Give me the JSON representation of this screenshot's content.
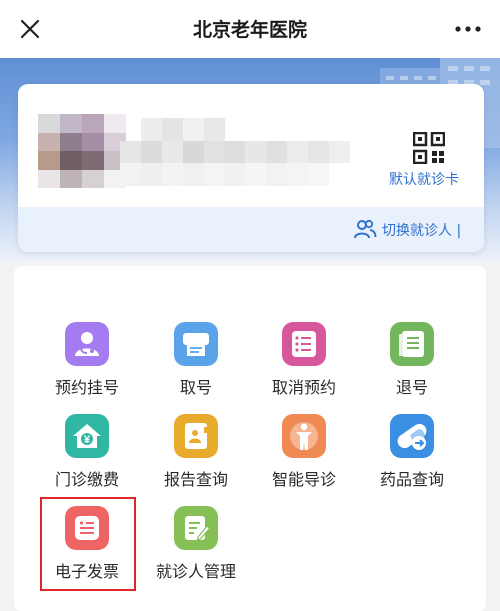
{
  "header": {
    "title": "北京老年医院",
    "close_icon": "close-icon",
    "more_icon": "more-icon"
  },
  "patient_card": {
    "qr_icon": "qr-code-icon",
    "card_link": "默认就诊卡",
    "switch_icon": "users-icon",
    "switch_label": "切换就诊人 |"
  },
  "services": [
    {
      "label": "预约挂号",
      "icon": "doctor-appointment-icon",
      "color": "#a47bf0"
    },
    {
      "label": "取号",
      "icon": "ticket-printer-icon",
      "color": "#5aa2ea"
    },
    {
      "label": "取消预约",
      "icon": "list-cancel-icon",
      "color": "#d6589a"
    },
    {
      "label": "退号",
      "icon": "document-icon",
      "color": "#73b65e"
    },
    {
      "label": "门诊缴费",
      "icon": "yuan-house-icon",
      "color": "#2fb7a3"
    },
    {
      "label": "报告查询",
      "icon": "report-book-icon",
      "color": "#e8ab2c"
    },
    {
      "label": "智能导诊",
      "icon": "body-guide-icon",
      "color": "#ef8a55"
    },
    {
      "label": "药品查询",
      "icon": "pill-icon",
      "color": "#3b8fe3"
    },
    {
      "label": "电子发票",
      "icon": "invoice-icon",
      "color": "#ee6363"
    },
    {
      "label": "就诊人管理",
      "icon": "patient-edit-icon",
      "color": "#86bf55"
    }
  ],
  "colors": {
    "accent_blue": "#2f6fd1",
    "highlight_red": "#e0242c"
  }
}
